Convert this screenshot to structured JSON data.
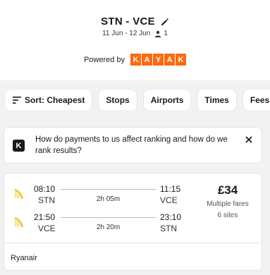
{
  "header": {
    "route": "STN - VCE",
    "dates": "11 Jun - 12 Jun",
    "passengers": "1",
    "powered_by": "Powered by",
    "brand_letters": [
      "K",
      "A",
      "Y",
      "A",
      "K"
    ],
    "brand_color": "#ff690f"
  },
  "filters": [
    {
      "label": "Sort: Cheapest",
      "icon": "sort-icon"
    },
    {
      "label": "Stops"
    },
    {
      "label": "Airports"
    },
    {
      "label": "Times"
    },
    {
      "label": "Fees"
    }
  ],
  "info_banner": {
    "logo": "K",
    "text": "How do payments to us affect ranking and how do we rank results?"
  },
  "result": {
    "legs": [
      {
        "dep_time": "08:10",
        "dep_airport": "STN",
        "duration": "2h 05m",
        "arr_time": "11:15",
        "arr_airport": "VCE"
      },
      {
        "dep_time": "21:50",
        "dep_airport": "VCE",
        "duration": "2h 20m",
        "arr_time": "23:10",
        "arr_airport": "STN"
      }
    ],
    "price": "£34",
    "fare_note": "Multiple fares",
    "sites": "6 sites",
    "airline": "Ryanair"
  }
}
